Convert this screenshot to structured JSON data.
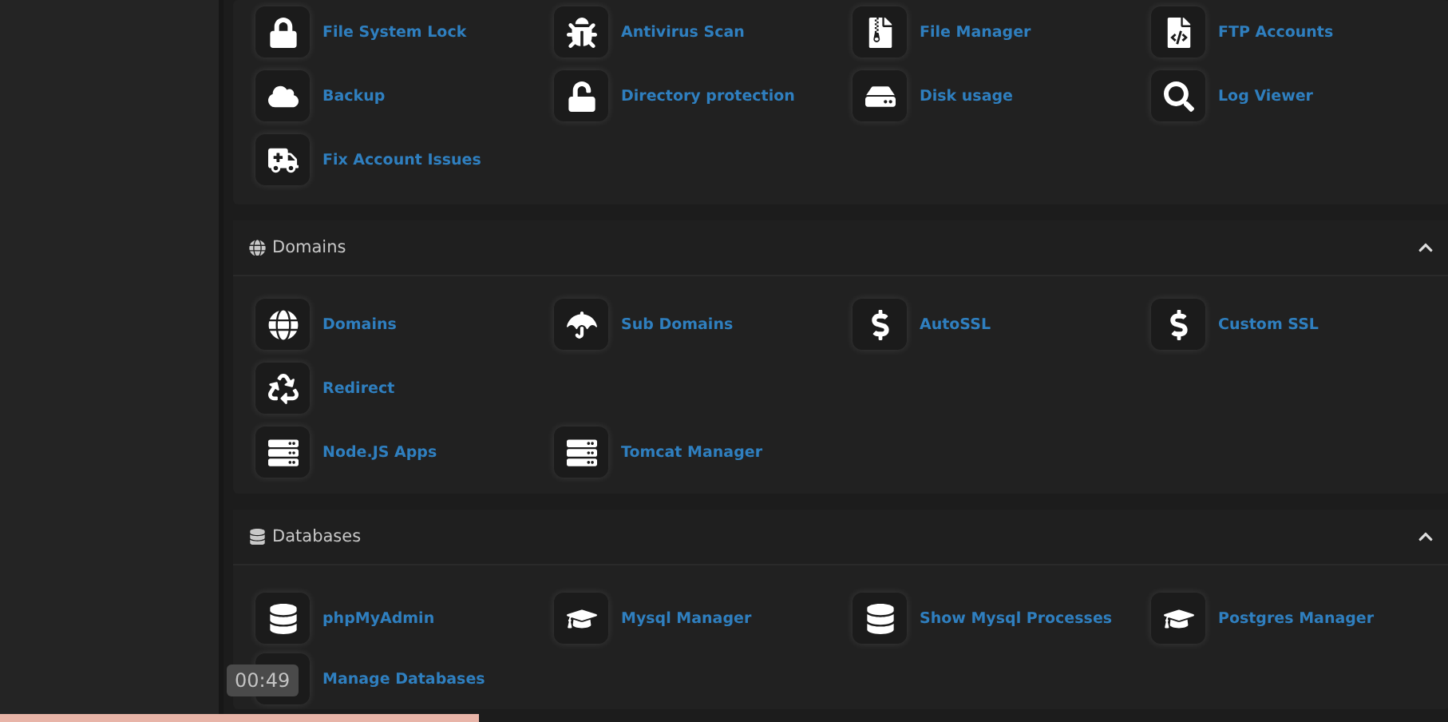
{
  "sections": [
    {
      "items": [
        {
          "label": "File System Lock"
        },
        {
          "label": "Antivirus Scan"
        },
        {
          "label": "File Manager"
        },
        {
          "label": "FTP Accounts"
        },
        {
          "label": "Backup"
        },
        {
          "label": "Directory protection"
        },
        {
          "label": "Disk usage"
        },
        {
          "label": "Log Viewer"
        },
        {
          "label": "Fix Account Issues"
        }
      ]
    },
    {
      "title": "Domains",
      "expanded": true,
      "items": [
        {
          "label": "Domains"
        },
        {
          "label": "Sub Domains"
        },
        {
          "label": "AutoSSL"
        },
        {
          "label": "Custom SSL"
        },
        {
          "label": "Redirect"
        },
        {
          "label": "Node.JS Apps"
        },
        {
          "label": "Tomcat Manager"
        }
      ]
    },
    {
      "title": "Databases",
      "expanded": true,
      "items": [
        {
          "label": "phpMyAdmin"
        },
        {
          "label": "Mysql Manager"
        },
        {
          "label": "Show Mysql Processes"
        },
        {
          "label": "Postgres Manager"
        },
        {
          "label": "Manage Databases"
        }
      ]
    }
  ],
  "video_timer": "00:49"
}
